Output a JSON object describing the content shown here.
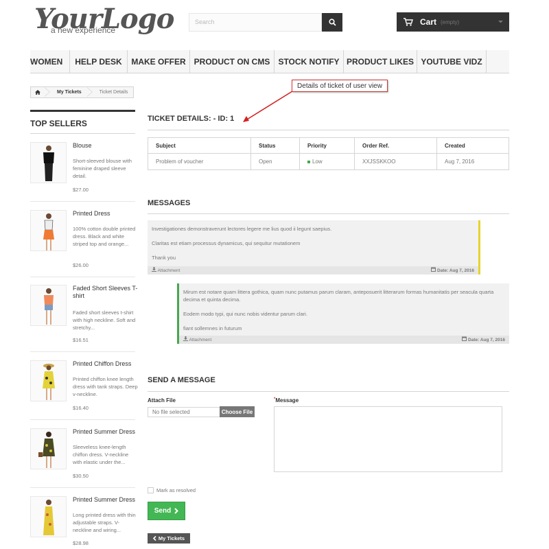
{
  "header": {
    "logo_main": "YourLogo",
    "logo_sub": "a new experience",
    "search_placeholder": "Search",
    "cart_label": "Cart",
    "cart_status": "(empty)"
  },
  "menu": [
    "WOMEN",
    "HELP DESK",
    "MAKE OFFER",
    "PRODUCT ON CMS",
    "STOCK NOTIFY",
    "PRODUCT LIKES",
    "YOUTUBE VIDZ"
  ],
  "breadcrumb": {
    "link": "My Tickets",
    "current": "Ticket Details"
  },
  "annotation": "Details of ticket of user view",
  "sidebar": {
    "title": "TOP SELLERS",
    "products": [
      {
        "name": "Blouse",
        "desc": "Short-sleeved blouse with feminine draped sleeve detail.",
        "price": "$27.00"
      },
      {
        "name": "Printed Dress",
        "desc": "100% cotton double printed dress. Black and white striped top and orange...",
        "price": "$26.00"
      },
      {
        "name": "Faded Short Sleeves T-shirt",
        "desc": "Faded short sleeves t-shirt with high neckline. Soft and stretchy...",
        "price": "$16.51"
      },
      {
        "name": "Printed Chiffon Dress",
        "desc": "Printed chiffon knee length dress with tank straps. Deep v-neckline.",
        "price": "$16.40"
      },
      {
        "name": "Printed Summer Dress",
        "desc": "Sleeveless knee-length chiffon dress. V-neckline with elastic under the...",
        "price": "$30.50"
      },
      {
        "name": "Printed Summer Dress",
        "desc": "Long printed dress with thin adjustable straps. V-neckline and wiring...",
        "price": "$28.98"
      }
    ]
  },
  "ticket": {
    "title": "TICKET DETAILS: - ID: 1",
    "headers": [
      "Subject",
      "Status",
      "Priority",
      "Order Ref.",
      "Created"
    ],
    "row": [
      "Problem of voucher",
      "Open",
      "Low",
      "XXJSSKKOO",
      "Aug 7, 2016"
    ]
  },
  "messages": {
    "title": "MESSAGES",
    "items": [
      {
        "lines": [
          "Investigationes demonstraverunt lectores legere me lius quod ii legunt saepius.",
          "Claritas est etiam processus dynamicus, qui sequitur mutationem",
          "Thank you"
        ],
        "attachment": "Attachment",
        "date": "Date: Aug 7, 2016",
        "accent": "#e8d32b"
      },
      {
        "lines": [
          "Mirum est notare quam littera gothica, quam nunc putamus parum claram, anteposuerit litterarum formas humanitatis per seacula quarta decima et quinta decima.",
          "Eodem modo typi, qui nunc nobis videntur parum clari.",
          "fiant sollemnes in futurum"
        ],
        "attachment": "Attachment",
        "date": "Date: Aug 7, 2016",
        "accent": "#46a74e"
      }
    ]
  },
  "send": {
    "title": "SEND A MESSAGE",
    "attach_label": "Attach File",
    "file_value": "No file selected",
    "file_button": "Choose File",
    "message_label": "Message",
    "required_mark": "*",
    "resolved_label": "Mark as resolved",
    "send_button": "Send",
    "back_button": "My Tickets"
  }
}
